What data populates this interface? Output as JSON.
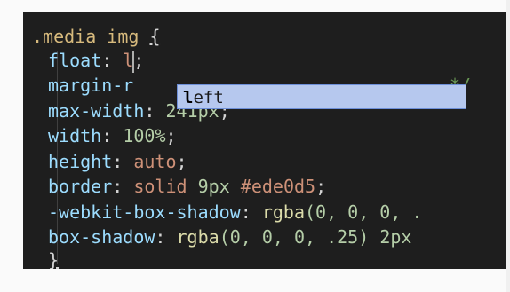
{
  "editor": {
    "selector": {
      "class": ".media",
      "tag": "img",
      "open_brace": "{"
    },
    "lines": [
      {
        "prop": "float",
        "value_before_cursor": "l",
        "end": ";"
      },
      {
        "prop": "margin-r",
        "hidden_suffix": "",
        "trailing_comment": "*/"
      },
      {
        "prop": "max-width",
        "num": "241",
        "unit": "px",
        "end": ";"
      },
      {
        "prop": "width",
        "num": "100",
        "unit": "%",
        "end": ";"
      },
      {
        "prop": "height",
        "value": "auto",
        "end": ";"
      },
      {
        "prop": "border",
        "value": "solid",
        "num": "9",
        "unit": "px",
        "color": "#ede0d5",
        "end": ";"
      },
      {
        "prop": "-webkit-box-shadow",
        "fn": "rgba",
        "args": "(0, 0, 0, .",
        "end": ""
      },
      {
        "prop": "box-shadow",
        "fn": "rgba",
        "args": "(0, 0, 0, .25)",
        "tail_num": "2",
        "tail_unit": "px"
      }
    ],
    "close_brace": "}"
  },
  "autocomplete": {
    "typed": "l",
    "rest": "eft"
  }
}
